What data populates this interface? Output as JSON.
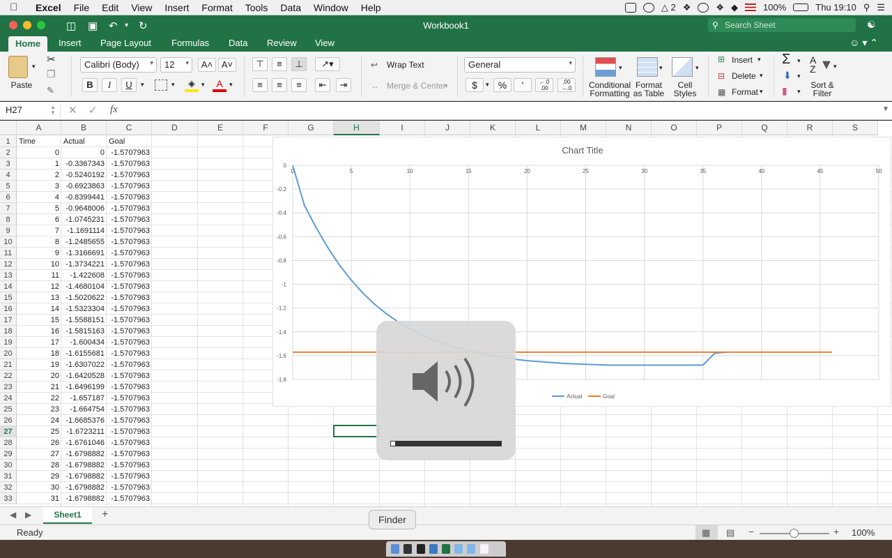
{
  "menubar": {
    "app": "Excel",
    "items": [
      "File",
      "Edit",
      "View",
      "Insert",
      "Format",
      "Tools",
      "Data",
      "Window",
      "Help"
    ],
    "status": {
      "adobe_count": "2",
      "battery": "100%",
      "clock": "Thu 19:10"
    }
  },
  "window": {
    "title": "Workbook1",
    "search_placeholder": "Search Sheet"
  },
  "ribbon": {
    "tabs": [
      "Home",
      "Insert",
      "Page Layout",
      "Formulas",
      "Data",
      "Review",
      "View"
    ],
    "active_tab": "Home",
    "paste_label": "Paste",
    "font_name": "Calibri (Body)",
    "font_size": "12",
    "bold": "B",
    "italic": "I",
    "underline": "U",
    "wrap_text": "Wrap Text",
    "merge_center": "Merge & Center",
    "number_format": "General",
    "currency": "$",
    "percent": "%",
    "comma": "'",
    "conditional_formatting": [
      "Conditional",
      "Formatting"
    ],
    "format_as_table": [
      "Format",
      "as Table"
    ],
    "cell_styles": [
      "Cell",
      "Styles"
    ],
    "insert": "Insert",
    "delete": "Delete",
    "format": "Format",
    "sort_filter": [
      "Sort &",
      "Filter"
    ]
  },
  "formula_bar": {
    "name_box": "H27",
    "fx": "fx"
  },
  "grid": {
    "columns": [
      "A",
      "B",
      "C",
      "D",
      "E",
      "F",
      "G",
      "H",
      "I",
      "J",
      "K",
      "L",
      "M",
      "N",
      "O",
      "P",
      "Q",
      "R",
      "S"
    ],
    "selected_column": "H",
    "selected_row": "27",
    "headers": [
      "Time",
      "Actual",
      "Goal"
    ],
    "rows": [
      [
        "0",
        "0",
        "-1.5707963"
      ],
      [
        "1",
        "-0.3367343",
        "-1.5707963"
      ],
      [
        "2",
        "-0.5240192",
        "-1.5707963"
      ],
      [
        "3",
        "-0.6923863",
        "-1.5707963"
      ],
      [
        "4",
        "-0.8399441",
        "-1.5707963"
      ],
      [
        "5",
        "-0.9648006",
        "-1.5707963"
      ],
      [
        "6",
        "-1.0745231",
        "-1.5707963"
      ],
      [
        "7",
        "-1.1691114",
        "-1.5707963"
      ],
      [
        "8",
        "-1.2485655",
        "-1.5707963"
      ],
      [
        "9",
        "-1.3166691",
        "-1.5707963"
      ],
      [
        "10",
        "-1.3734221",
        "-1.5707963"
      ],
      [
        "11",
        "-1.422608",
        "-1.5707963"
      ],
      [
        "12",
        "-1.4680104",
        "-1.5707963"
      ],
      [
        "13",
        "-1.5020622",
        "-1.5707963"
      ],
      [
        "14",
        "-1.5323304",
        "-1.5707963"
      ],
      [
        "15",
        "-1.5588151",
        "-1.5707963"
      ],
      [
        "16",
        "-1.5815163",
        "-1.5707963"
      ],
      [
        "17",
        "-1.600434",
        "-1.5707963"
      ],
      [
        "18",
        "-1.6155681",
        "-1.5707963"
      ],
      [
        "19",
        "-1.6307022",
        "-1.5707963"
      ],
      [
        "20",
        "-1.6420528",
        "-1.5707963"
      ],
      [
        "21",
        "-1.6496199",
        "-1.5707963"
      ],
      [
        "22",
        "-1.657187",
        "-1.5707963"
      ],
      [
        "23",
        "-1.664754",
        "-1.5707963"
      ],
      [
        "24",
        "-1.6685376",
        "-1.5707963"
      ],
      [
        "25",
        "-1.6723211",
        "-1.5707963"
      ],
      [
        "26",
        "-1.6761046",
        "-1.5707963"
      ],
      [
        "27",
        "-1.6798882",
        "-1.5707963"
      ],
      [
        "28",
        "-1.6798882",
        "-1.5707963"
      ],
      [
        "29",
        "-1.6798882",
        "-1.5707963"
      ],
      [
        "30",
        "-1.6798882",
        "-1.5707963"
      ],
      [
        "31",
        "-1.6798882",
        "-1.5707963"
      ]
    ]
  },
  "chart_data": {
    "type": "line",
    "title": "Chart Title",
    "xlim": [
      0,
      50
    ],
    "ylim": [
      -1.8,
      0
    ],
    "x_ticks": [
      0,
      5,
      10,
      15,
      20,
      25,
      30,
      35,
      40,
      45,
      50
    ],
    "y_ticks": [
      0,
      -0.2,
      -0.4,
      -0.6,
      -0.8,
      -1,
      -1.2,
      -1.4,
      -1.6,
      -1.8
    ],
    "x_tick_labels": [
      "0",
      "5",
      "10",
      "15",
      "20",
      "25",
      "30",
      "35",
      "40",
      "45",
      "50"
    ],
    "y_tick_labels": [
      "0",
      "-0.2",
      "-0.4",
      "-0.6",
      "-0.8",
      "-1",
      "-1.2",
      "-1.4",
      "-1.6",
      "-1.8"
    ],
    "grid": true,
    "legend": "bottom",
    "series": [
      {
        "name": "Actual",
        "color": "#5b9bd5",
        "x": [
          0,
          1,
          2,
          3,
          4,
          5,
          6,
          7,
          8,
          9,
          10,
          11,
          12,
          13,
          14,
          15,
          16,
          17,
          18,
          19,
          20,
          21,
          22,
          23,
          24,
          25,
          26,
          27,
          28,
          29,
          30,
          31,
          32,
          33,
          34,
          35,
          36,
          37
        ],
        "y": [
          0,
          -0.3367343,
          -0.5240192,
          -0.6923863,
          -0.8399441,
          -0.9648006,
          -1.0745231,
          -1.1691114,
          -1.2485655,
          -1.3166691,
          -1.3734221,
          -1.422608,
          -1.4680104,
          -1.5020622,
          -1.5323304,
          -1.5588151,
          -1.5815163,
          -1.600434,
          -1.6155681,
          -1.6307022,
          -1.6420528,
          -1.6496199,
          -1.657187,
          -1.664754,
          -1.6685376,
          -1.6723211,
          -1.6761046,
          -1.6798882,
          -1.6798882,
          -1.6798882,
          -1.6798882,
          -1.6798882,
          -1.68,
          -1.68,
          -1.68,
          -1.68,
          -1.58,
          -1.57
        ]
      },
      {
        "name": "Goal",
        "color": "#ed7d31",
        "x": [
          0,
          46
        ],
        "y": [
          -1.5707963,
          -1.5707963
        ]
      }
    ]
  },
  "sheet": {
    "tab": "Sheet1",
    "add": "+"
  },
  "status": {
    "text": "Ready",
    "zoom": "100%"
  },
  "volume": {
    "level": 0.04
  },
  "tooltip": {
    "finder": "Finder"
  }
}
